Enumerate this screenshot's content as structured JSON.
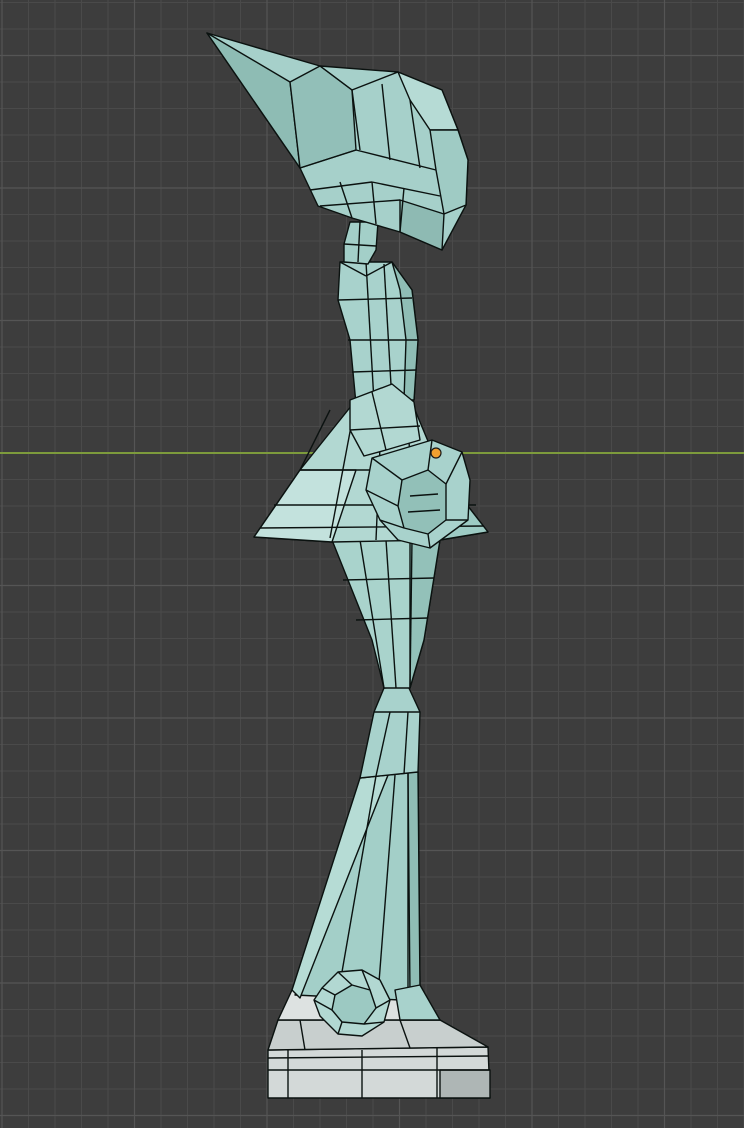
{
  "viewport": {
    "background": "#3d3d3d",
    "grid_minor_color": "#4a4a4a",
    "grid_major_color": "#555555",
    "horizon_axis_color": "#7a9a3a",
    "mesh_fill": "#a8d2cc",
    "mesh_fill_dark": "#8fbdb5",
    "mesh_fill_light": "#b9ddd7",
    "base_fill": "#d6dcdb",
    "base_fill_dark": "#b9c1c0",
    "wire_color": "#0b1210",
    "origin_color": "#f0a030"
  },
  "model": {
    "name_icon": "character-mesh",
    "origin_icon": "object-origin-dot"
  }
}
